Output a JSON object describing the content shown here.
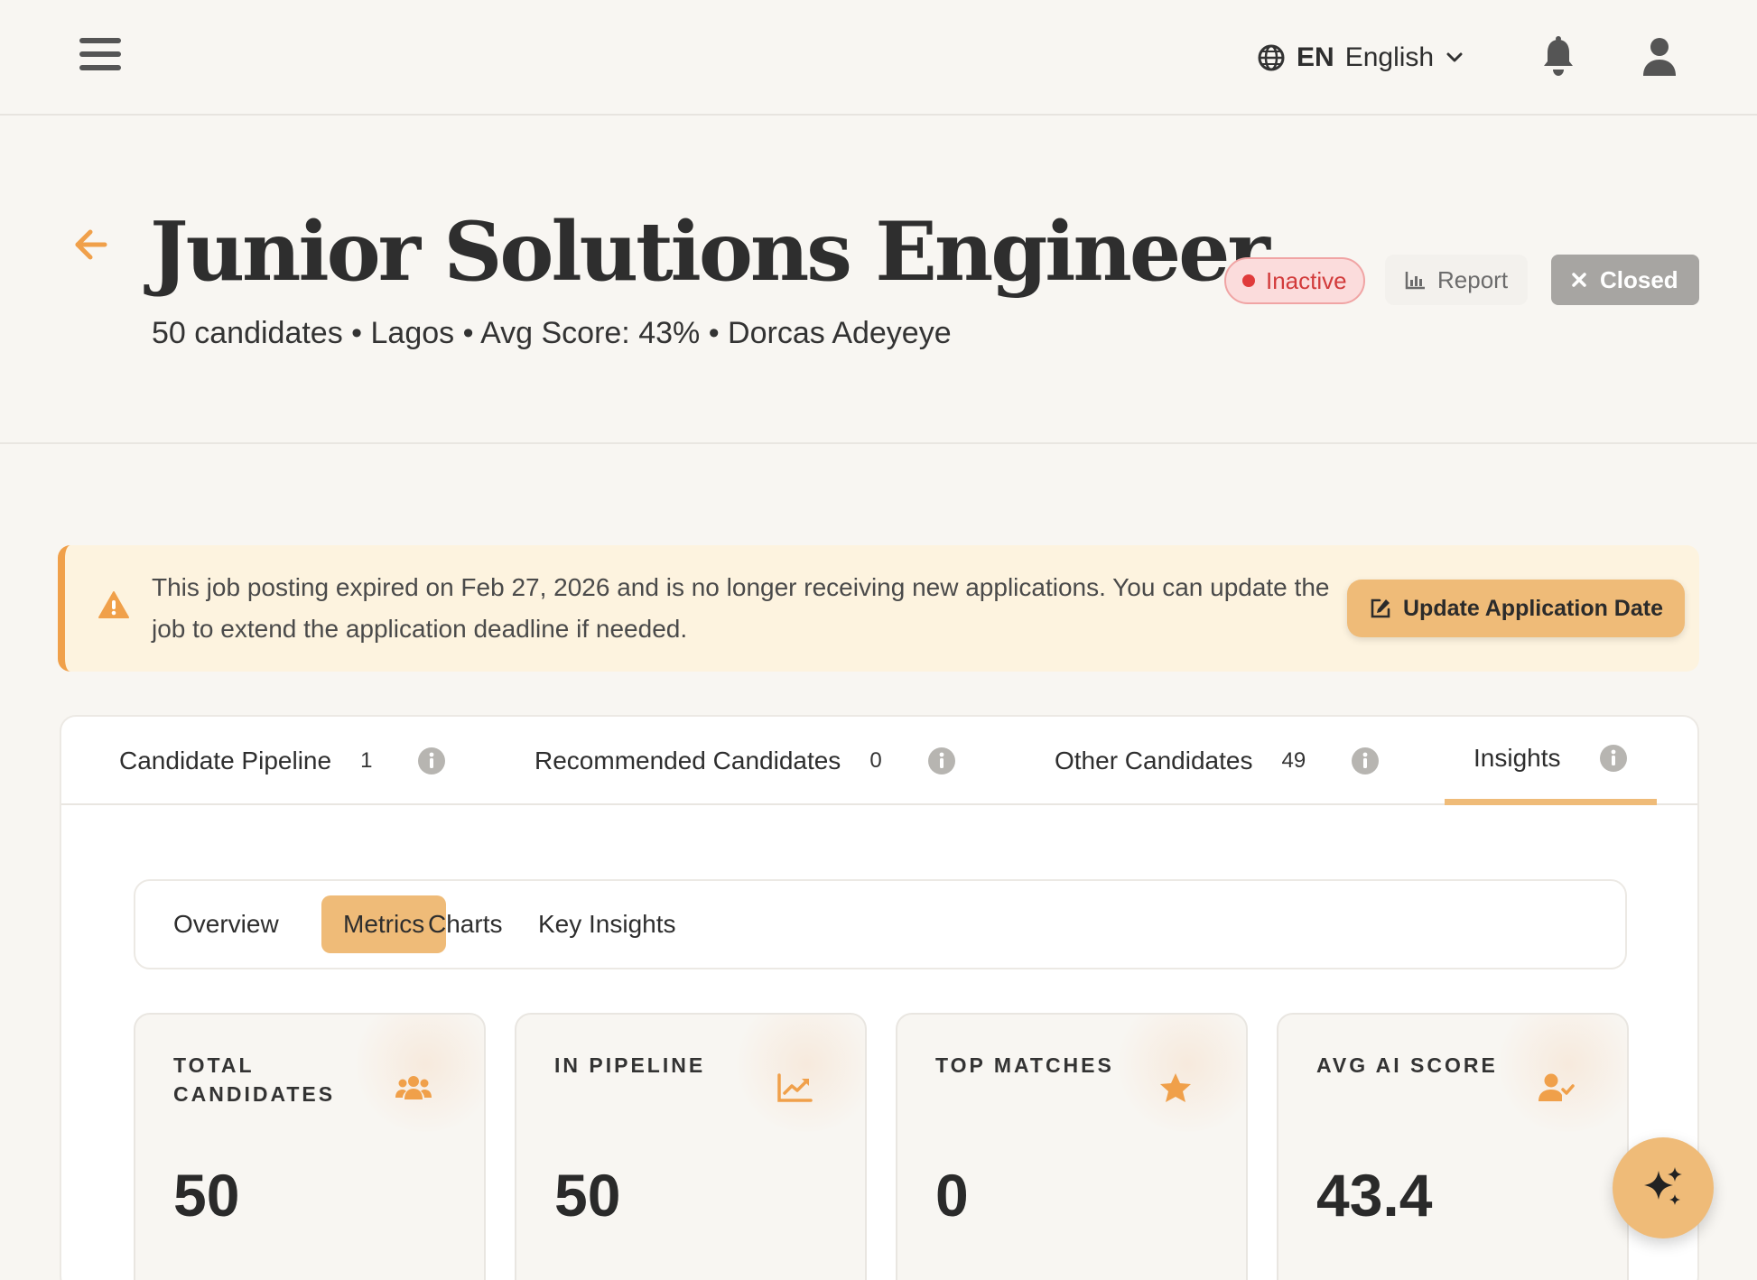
{
  "topbar": {
    "language_code": "EN",
    "language_name": "English"
  },
  "job": {
    "title": "Junior Solutions Engineer",
    "subtitle": "50 candidates • Lagos • Avg Score: 43% • Dorcas Adeyeye",
    "status": "Inactive",
    "report_label": "Report",
    "closed_label": "Closed"
  },
  "alert": {
    "message": "This job posting expired on Feb 27, 2026 and is no longer receiving new applications. You can update the job to extend the application deadline if needed.",
    "action_label": "Update Application Date"
  },
  "tabs": [
    {
      "label": "Candidate Pipeline",
      "count": "1"
    },
    {
      "label": "Recommended Candidates",
      "count": "0"
    },
    {
      "label": "Other Candidates",
      "count": "49"
    },
    {
      "label": "Insights",
      "count": ""
    }
  ],
  "active_tab": "Insights",
  "subtabs": [
    {
      "label": "Overview"
    },
    {
      "label": "Metrics"
    },
    {
      "label": "Charts"
    },
    {
      "label": "Key Insights"
    }
  ],
  "active_subtab": "Metrics",
  "metrics": [
    {
      "label": "Total Candidates",
      "value": "50",
      "icon": "users-icon"
    },
    {
      "label": "In Pipeline",
      "value": "50",
      "icon": "chart-line-icon"
    },
    {
      "label": "Top Matches",
      "value": "0",
      "icon": "star-icon"
    },
    {
      "label": "Avg AI Score",
      "value": "43.4",
      "icon": "user-check-icon"
    }
  ],
  "colors": {
    "accent": "#efbb78",
    "accent_dark": "#f0a04a",
    "inactive": "#d23b3b",
    "background": "#f8f6f2"
  }
}
